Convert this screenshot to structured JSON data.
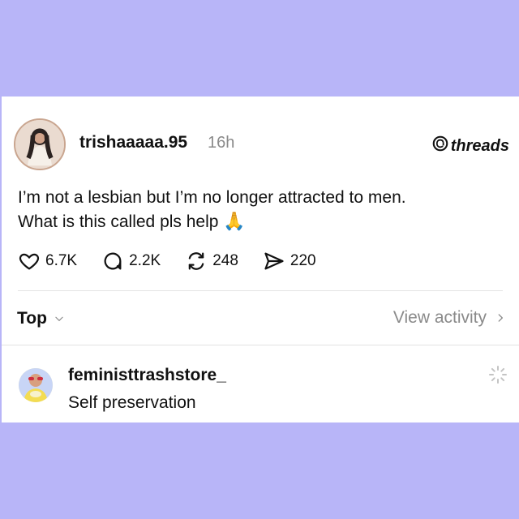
{
  "post": {
    "username": "trishaaaaa.95",
    "timestamp": "16h",
    "brand": "threads",
    "text_line1": "I’m not a lesbian but I’m no longer attracted to men.",
    "text_line2": "What is this called pls help",
    "emoji": "🙏",
    "actions": {
      "likes": "6.7K",
      "replies": "2.2K",
      "reposts": "248",
      "shares": "220"
    }
  },
  "filters": {
    "sort_label": "Top",
    "view_activity_label": "View activity"
  },
  "reply": {
    "username": "feministtrashstore_",
    "text": "Self preservation"
  },
  "colors": {
    "background": "#b8b5f8",
    "card": "#ffffff",
    "text": "#111111",
    "muted": "#8a8a8a"
  }
}
